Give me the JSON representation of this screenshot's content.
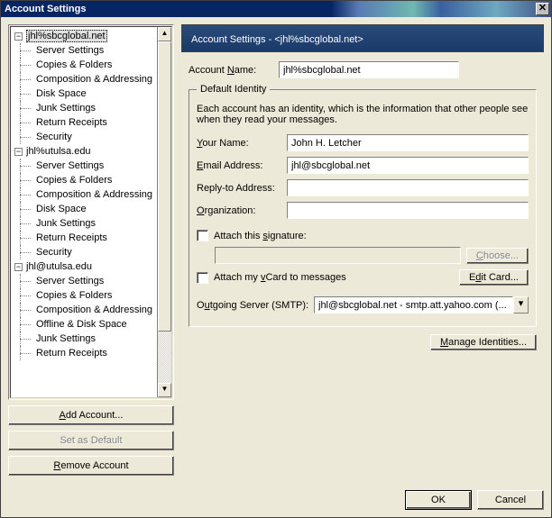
{
  "window": {
    "title": "Account Settings"
  },
  "tree": {
    "accounts": [
      {
        "name": "jhl%sbcglobal.net",
        "expanded": true,
        "selected": true,
        "items": [
          "Server Settings",
          "Copies & Folders",
          "Composition & Addressing",
          "Disk Space",
          "Junk Settings",
          "Return Receipts",
          "Security"
        ]
      },
      {
        "name": "jhl%utulsa.edu",
        "expanded": true,
        "selected": false,
        "items": [
          "Server Settings",
          "Copies & Folders",
          "Composition & Addressing",
          "Disk Space",
          "Junk Settings",
          "Return Receipts",
          "Security"
        ]
      },
      {
        "name": "jhl@utulsa.edu",
        "expanded": true,
        "selected": false,
        "items": [
          "Server Settings",
          "Copies & Folders",
          "Composition & Addressing",
          "Offline & Disk Space",
          "Junk Settings",
          "Return Receipts"
        ]
      }
    ]
  },
  "left_buttons": {
    "add": "Add Account...",
    "default": "Set as Default",
    "remove": "Remove Account"
  },
  "panel": {
    "heading_prefix": "Account Settings - ",
    "heading_account": "<jhl%sbcglobal.net>",
    "account_name_label_pre": "Account ",
    "account_name_label_u": "N",
    "account_name_label_post": "ame:",
    "account_name_value": "jhl%sbcglobal.net",
    "fieldset_legend": "Default Identity",
    "desc": "Each account has an identity, which is the information that other people see when they read your messages.",
    "your_name_u": "Y",
    "your_name_post": "our Name:",
    "your_name_value": "John H. Letcher",
    "email_u": "E",
    "email_post": "mail Address:",
    "email_value": "jhl@sbcglobal.net",
    "reply_label": "Reply-to Address:",
    "reply_value": "",
    "org_u": "O",
    "org_post": "rganization:",
    "org_value": "",
    "attach_sig_pre": "Attach this ",
    "attach_sig_u": "s",
    "attach_sig_post": "ignature:",
    "choose_u": "C",
    "choose_post": "hoose...",
    "vcard_pre": "Attach my ",
    "vcard_u": "v",
    "vcard_post": "Card to messages",
    "editcard_pre": "E",
    "editcard_u": "d",
    "editcard_post": "it Card...",
    "smtp_pre": "O",
    "smtp_u": "u",
    "smtp_post": "tgoing Server (SMTP):",
    "smtp_value": "jhl@sbcglobal.net - smtp.att.yahoo.com (...",
    "manage_u": "M",
    "manage_post": "anage Identities..."
  },
  "footer": {
    "ok": "OK",
    "cancel": "Cancel"
  }
}
